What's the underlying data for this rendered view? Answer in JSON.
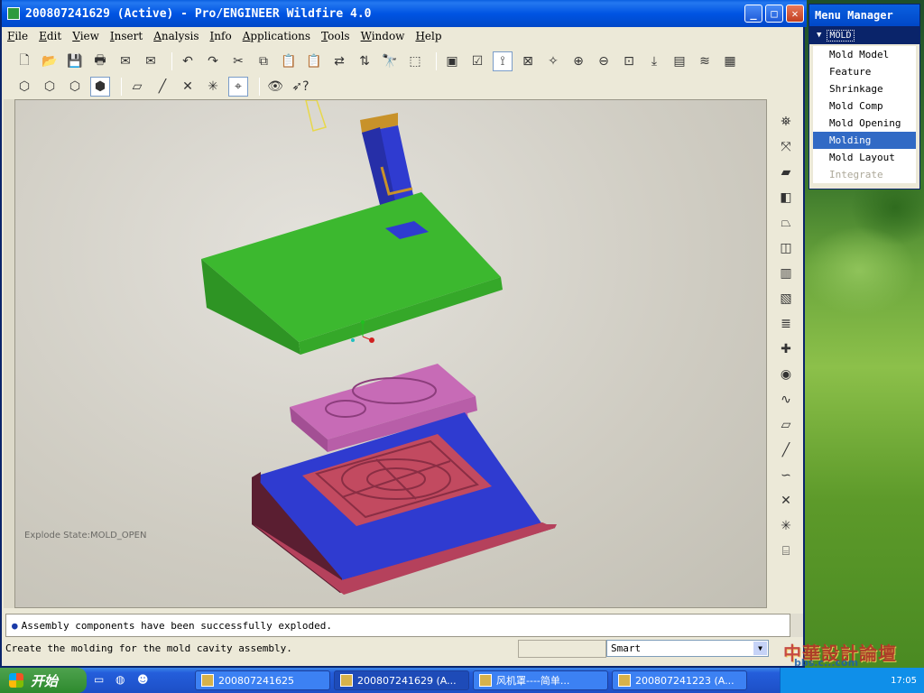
{
  "window": {
    "title": "200807241629 (Active) - Pro/ENGINEER Wildfire 4.0",
    "minimize_label": "_",
    "maximize_label": "□",
    "close_label": "✕"
  },
  "menubar": [
    "File",
    "Edit",
    "View",
    "Insert",
    "Analysis",
    "Info",
    "Applications",
    "Tools",
    "Window",
    "Help"
  ],
  "graphics": {
    "explode_state": "Explode State:MOLD_OPEN"
  },
  "message_area": {
    "message": "Assembly components have been successfully exploded."
  },
  "status_bar": {
    "prompt": "Create the molding for the mold cavity assembly.",
    "filter_value": "Smart"
  },
  "menu_manager": {
    "title": "Menu Manager",
    "header": "MOLD",
    "items": [
      {
        "label": "Mold Model",
        "state": "normal"
      },
      {
        "label": "Feature",
        "state": "normal"
      },
      {
        "label": "Shrinkage",
        "state": "normal"
      },
      {
        "label": "Mold Comp",
        "state": "normal"
      },
      {
        "label": "Mold Opening",
        "state": "normal"
      },
      {
        "label": "Molding",
        "state": "selected"
      },
      {
        "label": "Mold Layout",
        "state": "normal"
      },
      {
        "label": "Integrate",
        "state": "disabled"
      }
    ]
  },
  "taskbar": {
    "start_label": "开始",
    "tasks": [
      "200807241625",
      "200807241629 (A...",
      "风机罩----简单...",
      "200807241223 (A..."
    ],
    "clock": "17:05"
  },
  "watermark": {
    "text": "中華設計論壇",
    "url": "bbs.c...com"
  },
  "colors": {
    "title_bar": "#0054e3",
    "green_plate": "#3cb82f",
    "mold_blue": "#2f3bd0",
    "mold_red": "#b5415c",
    "pink_part": "#c76bb6",
    "selection": "#316ac5"
  }
}
